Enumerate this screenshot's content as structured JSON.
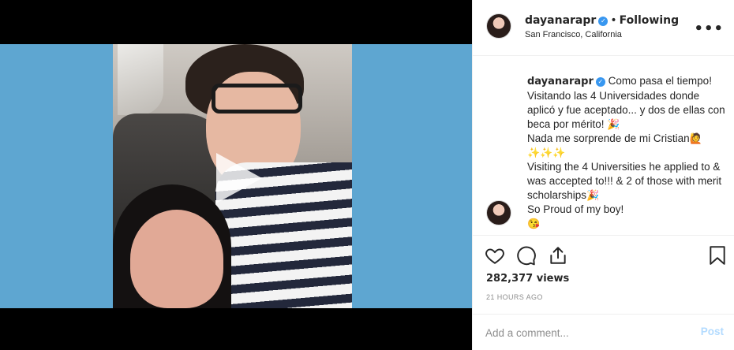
{
  "post": {
    "username": "dayanarapr",
    "separator": "•",
    "follow_status": "Following",
    "location": "San Francisco, California",
    "more_label": "•••",
    "verified_glyph": "✓"
  },
  "caption": {
    "username": "dayanarapr",
    "line1": "Como pasa el tiempo! Visitando las 4 Universidades donde aplicó y fue aceptado... y dos de ellas con beca por mérito!",
    "emoji1": "🎉",
    "line2": "Nada me sorprende de mi Cristian",
    "emoji2": "🙋",
    "emoji3": "✨✨✨",
    "line3": "Visiting the 4 Universities he applied to & was accepted to!!! & 2 of those with merit scholarships",
    "emoji4": "🎉",
    "line4": "So Proud of my boy!",
    "emoji5": "😘"
  },
  "stats": {
    "views": "282,377 views",
    "timestamp": "21 HOURS AGO"
  },
  "comment_box": {
    "placeholder": "Add a comment...",
    "post_label": "Post"
  },
  "icons": {
    "play": "play-icon",
    "like": "heart-icon",
    "comment": "comment-bubble-icon",
    "share": "share-icon",
    "save": "bookmark-icon",
    "more": "more-options-icon"
  },
  "colors": {
    "accent": "#3897f0",
    "post_disabled": "#b3dbff",
    "frame_bg": "#5ea6d1"
  }
}
